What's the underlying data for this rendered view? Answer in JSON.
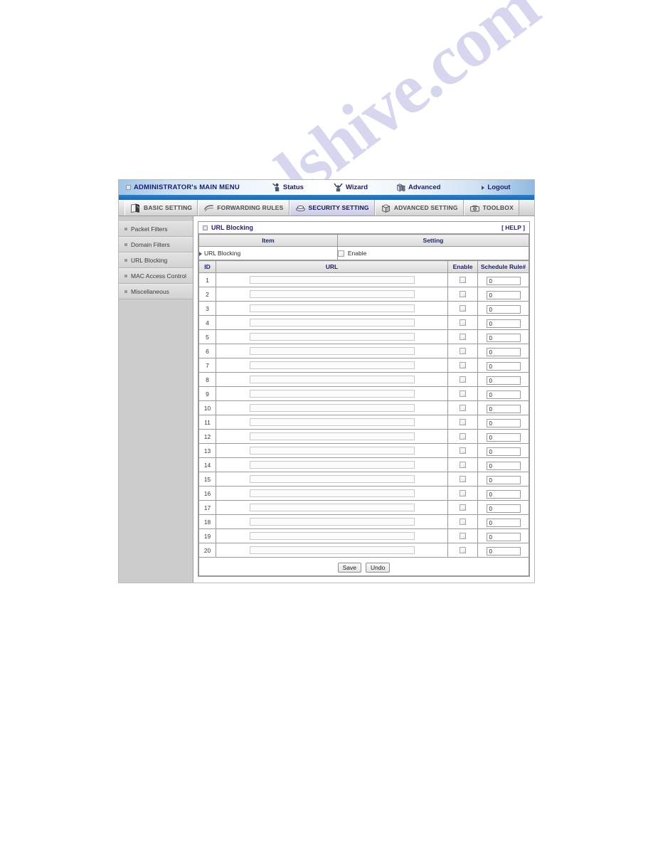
{
  "topbar": {
    "admin_menu": "ADMINISTRATOR's MAIN MENU",
    "admin_icon": "window-square-icon",
    "items": [
      {
        "label": "Status",
        "icon": "person-status-icon"
      },
      {
        "label": "Wizard",
        "icon": "wizard-wand-icon"
      },
      {
        "label": "Advanced",
        "icon": "boxes-advanced-icon"
      },
      {
        "label": "Logout",
        "icon": "arrow-right-icon"
      }
    ]
  },
  "tabs": [
    {
      "label": "BASIC SETTING",
      "icon": "notebook-icon",
      "active": false
    },
    {
      "label": "FORWARDING RULES",
      "icon": "arrows-icon",
      "active": false
    },
    {
      "label": "SECURITY SETTING",
      "icon": "shield-lock-icon",
      "active": true
    },
    {
      "label": "ADVANCED SETTING",
      "icon": "box-open-icon",
      "active": false
    },
    {
      "label": "TOOLBOX",
      "icon": "toolbox-icon",
      "active": false
    }
  ],
  "sidebar": {
    "items": [
      {
        "label": "Packet Filters"
      },
      {
        "label": "Domain Filters"
      },
      {
        "label": "URL Blocking"
      },
      {
        "label": "MAC Access Control"
      },
      {
        "label": "Miscellaneous"
      }
    ]
  },
  "panel": {
    "title": "URL Blocking",
    "title_icon": "window-square-icon",
    "help_label": "[ HELP ]",
    "settings_table": {
      "headers": {
        "item": "Item",
        "setting": "Setting"
      },
      "rows": [
        {
          "item": "URL Blocking",
          "setting_label": "Enable",
          "checked": false
        }
      ]
    },
    "url_table": {
      "headers": {
        "id": "ID",
        "url": "URL",
        "enable": "Enable",
        "schedule": "Schedule Rule#"
      },
      "rows": [
        {
          "id": "1",
          "url": "",
          "enable": false,
          "schedule": "0"
        },
        {
          "id": "2",
          "url": "",
          "enable": false,
          "schedule": "0"
        },
        {
          "id": "3",
          "url": "",
          "enable": false,
          "schedule": "0"
        },
        {
          "id": "4",
          "url": "",
          "enable": false,
          "schedule": "0"
        },
        {
          "id": "5",
          "url": "",
          "enable": false,
          "schedule": "0"
        },
        {
          "id": "6",
          "url": "",
          "enable": false,
          "schedule": "0"
        },
        {
          "id": "7",
          "url": "",
          "enable": false,
          "schedule": "0"
        },
        {
          "id": "8",
          "url": "",
          "enable": false,
          "schedule": "0"
        },
        {
          "id": "9",
          "url": "",
          "enable": false,
          "schedule": "0"
        },
        {
          "id": "10",
          "url": "",
          "enable": false,
          "schedule": "0"
        },
        {
          "id": "11",
          "url": "",
          "enable": false,
          "schedule": "0"
        },
        {
          "id": "12",
          "url": "",
          "enable": false,
          "schedule": "0"
        },
        {
          "id": "13",
          "url": "",
          "enable": false,
          "schedule": "0"
        },
        {
          "id": "14",
          "url": "",
          "enable": false,
          "schedule": "0"
        },
        {
          "id": "15",
          "url": "",
          "enable": false,
          "schedule": "0"
        },
        {
          "id": "16",
          "url": "",
          "enable": false,
          "schedule": "0"
        },
        {
          "id": "17",
          "url": "",
          "enable": false,
          "schedule": "0"
        },
        {
          "id": "18",
          "url": "",
          "enable": false,
          "schedule": "0"
        },
        {
          "id": "19",
          "url": "",
          "enable": false,
          "schedule": "0"
        },
        {
          "id": "20",
          "url": "",
          "enable": false,
          "schedule": "0"
        }
      ]
    },
    "buttons": {
      "save": "Save",
      "undo": "Undo"
    }
  },
  "watermark": {
    "text": "manualshive.com"
  },
  "colors": {
    "heading_blue": "#23236b",
    "topbar_blue": "#2a2aa8",
    "blue_strip": "#2f7ec4",
    "sidebar_gray": "#cccccc",
    "active_tab": "#dcdcee",
    "watermark": "#787ac8"
  }
}
